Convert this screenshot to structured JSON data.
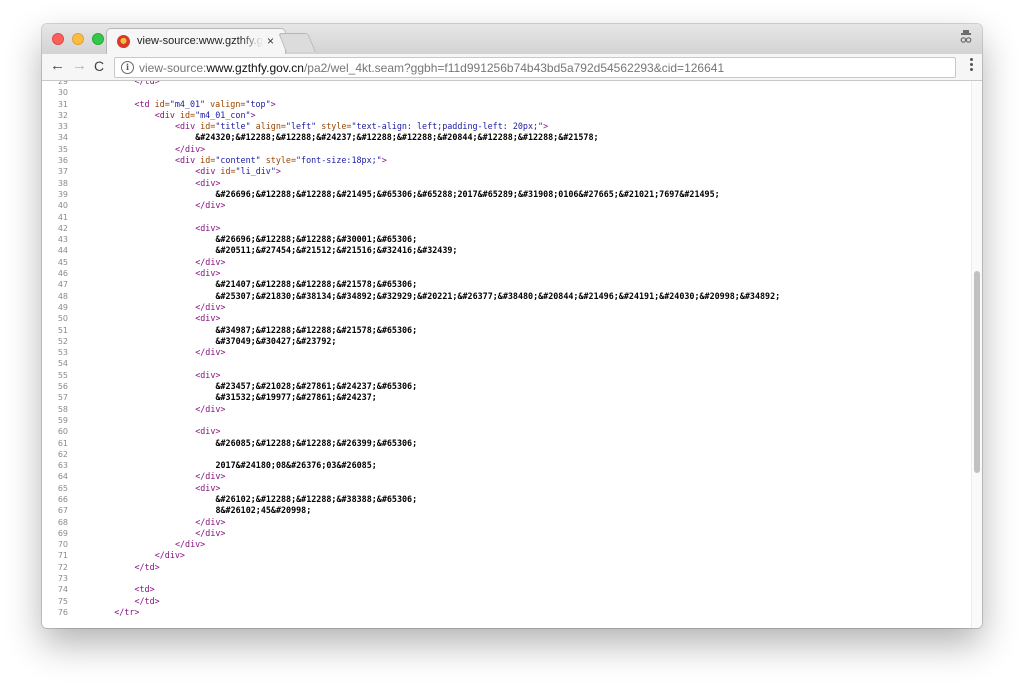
{
  "tab": {
    "title": "view-source:www.gzthfy.gov.cn",
    "close": "×"
  },
  "toolbar": {
    "url_scheme": "view-source:",
    "url_host": "www.gzthfy.gov.cn",
    "url_path": "/pa2/wel_4kt.seam?ggbh=f11d991256b74b43bd5a792d54562293&cid=126641",
    "back": "←",
    "forward": "→",
    "reload": "C"
  },
  "icons": {
    "favicon": "favicon-icon",
    "close": "close-icon",
    "profile": "incognito-icon",
    "back": "arrow-left-icon",
    "forward": "arrow-right-icon",
    "reload": "reload-icon",
    "info": "info-icon",
    "menu": "kebab-menu-icon"
  },
  "colors": {
    "tag": "#881280",
    "attribute": "#994500",
    "value": "#1a1aa6"
  },
  "source_lines": [
    {
      "n": "29",
      "indent": 8,
      "parts": [
        [
          "t",
          "</td>"
        ]
      ]
    },
    {
      "n": "30",
      "indent": 0,
      "parts": []
    },
    {
      "n": "31",
      "indent": 8,
      "parts": [
        [
          "t",
          "<td "
        ],
        [
          "a",
          "id="
        ],
        [
          "v",
          "\"m4_01\""
        ],
        [
          "a",
          " valign="
        ],
        [
          "v",
          "\"top\""
        ],
        [
          "t",
          ">"
        ]
      ]
    },
    {
      "n": "32",
      "indent": 12,
      "parts": [
        [
          "t",
          "<div "
        ],
        [
          "a",
          "id="
        ],
        [
          "v",
          "\"m4_01_con\""
        ],
        [
          "t",
          ">"
        ]
      ]
    },
    {
      "n": "33",
      "indent": 16,
      "parts": [
        [
          "t",
          "<div "
        ],
        [
          "a",
          "id="
        ],
        [
          "v",
          "\"title\""
        ],
        [
          "a",
          " align="
        ],
        [
          "v",
          "\"left\""
        ],
        [
          "a",
          " style="
        ],
        [
          "v",
          "\"text-align: left;padding-left: 20px;\""
        ],
        [
          "t",
          ">"
        ]
      ]
    },
    {
      "n": "34",
      "indent": 20,
      "parts": [
        [
          "x",
          "&#24320;&#12288;&#12288;&#24237;&#12288;&#12288;&#20844;&#12288;&#12288;&#21578;"
        ]
      ]
    },
    {
      "n": "35",
      "indent": 16,
      "parts": [
        [
          "t",
          "</div>"
        ]
      ]
    },
    {
      "n": "36",
      "indent": 16,
      "parts": [
        [
          "t",
          "<div "
        ],
        [
          "a",
          "id="
        ],
        [
          "v",
          "\"content\""
        ],
        [
          "a",
          " style="
        ],
        [
          "v",
          "\"font-size:18px;\""
        ],
        [
          "t",
          ">"
        ]
      ]
    },
    {
      "n": "37",
      "indent": 20,
      "parts": [
        [
          "t",
          "<div "
        ],
        [
          "a",
          "id="
        ],
        [
          "v",
          "\"li_div\""
        ],
        [
          "t",
          ">"
        ]
      ]
    },
    {
      "n": "38",
      "indent": 20,
      "parts": [
        [
          "t",
          "<div>"
        ]
      ]
    },
    {
      "n": "39",
      "indent": 24,
      "parts": [
        [
          "x",
          "&#26696;&#12288;&#12288;&#21495;&#65306;&#65288;2017&#65289;&#31908;0106&#27665;&#21021;7697&#21495;"
        ]
      ]
    },
    {
      "n": "40",
      "indent": 20,
      "parts": [
        [
          "t",
          "</div>"
        ]
      ]
    },
    {
      "n": "41",
      "indent": 0,
      "parts": []
    },
    {
      "n": "42",
      "indent": 20,
      "parts": [
        [
          "t",
          "<div>"
        ]
      ]
    },
    {
      "n": "43",
      "indent": 24,
      "parts": [
        [
          "x",
          "&#26696;&#12288;&#12288;&#30001;&#65306;"
        ]
      ]
    },
    {
      "n": "44",
      "indent": 24,
      "parts": [
        [
          "x",
          "&#20511;&#27454;&#21512;&#21516;&#32416;&#32439;"
        ]
      ]
    },
    {
      "n": "45",
      "indent": 20,
      "parts": [
        [
          "t",
          "</div>"
        ]
      ]
    },
    {
      "n": "46",
      "indent": 20,
      "parts": [
        [
          "t",
          "<div>"
        ]
      ]
    },
    {
      "n": "47",
      "indent": 24,
      "parts": [
        [
          "x",
          "&#21407;&#12288;&#12288;&#21578;&#65306;"
        ]
      ]
    },
    {
      "n": "48",
      "indent": 24,
      "parts": [
        [
          "x",
          "&#25307;&#21830;&#38134;&#34892;&#32929;&#20221;&#26377;&#38480;&#20844;&#21496;&#24191;&#24030;&#20998;&#34892;"
        ]
      ]
    },
    {
      "n": "49",
      "indent": 20,
      "parts": [
        [
          "t",
          "</div>"
        ]
      ]
    },
    {
      "n": "50",
      "indent": 20,
      "parts": [
        [
          "t",
          "<div>"
        ]
      ]
    },
    {
      "n": "51",
      "indent": 24,
      "parts": [
        [
          "x",
          "&#34987;&#12288;&#12288;&#21578;&#65306;"
        ]
      ]
    },
    {
      "n": "52",
      "indent": 24,
      "parts": [
        [
          "x",
          "&#37049;&#30427;&#23792;"
        ]
      ]
    },
    {
      "n": "53",
      "indent": 20,
      "parts": [
        [
          "t",
          "</div>"
        ]
      ]
    },
    {
      "n": "54",
      "indent": 0,
      "parts": []
    },
    {
      "n": "55",
      "indent": 20,
      "parts": [
        [
          "t",
          "<div>"
        ]
      ]
    },
    {
      "n": "56",
      "indent": 24,
      "parts": [
        [
          "x",
          "&#23457;&#21028;&#27861;&#24237;&#65306;"
        ]
      ]
    },
    {
      "n": "57",
      "indent": 24,
      "parts": [
        [
          "x",
          "&#31532;&#19977;&#27861;&#24237;"
        ]
      ]
    },
    {
      "n": "58",
      "indent": 20,
      "parts": [
        [
          "t",
          "</div>"
        ]
      ]
    },
    {
      "n": "59",
      "indent": 0,
      "parts": []
    },
    {
      "n": "60",
      "indent": 20,
      "parts": [
        [
          "t",
          "<div>"
        ]
      ]
    },
    {
      "n": "61",
      "indent": 24,
      "parts": [
        [
          "x",
          "&#26085;&#12288;&#12288;&#26399;&#65306;"
        ]
      ]
    },
    {
      "n": "62",
      "indent": 0,
      "parts": []
    },
    {
      "n": "63",
      "indent": 24,
      "parts": [
        [
          "x",
          "2017&#24180;08&#26376;03&#26085;"
        ]
      ]
    },
    {
      "n": "64",
      "indent": 20,
      "parts": [
        [
          "t",
          "</div>"
        ]
      ]
    },
    {
      "n": "65",
      "indent": 20,
      "parts": [
        [
          "t",
          "<div>"
        ]
      ]
    },
    {
      "n": "66",
      "indent": 24,
      "parts": [
        [
          "x",
          "&#26102;&#12288;&#12288;&#38388;&#65306;"
        ]
      ]
    },
    {
      "n": "67",
      "indent": 24,
      "parts": [
        [
          "x",
          "8&#26102;45&#20998;"
        ]
      ]
    },
    {
      "n": "68",
      "indent": 20,
      "parts": [
        [
          "t",
          "</div>"
        ]
      ]
    },
    {
      "n": "69",
      "indent": 20,
      "parts": [
        [
          "t",
          "</div>"
        ]
      ]
    },
    {
      "n": "70",
      "indent": 16,
      "parts": [
        [
          "t",
          "</div>"
        ]
      ]
    },
    {
      "n": "71",
      "indent": 12,
      "parts": [
        [
          "t",
          "</div>"
        ]
      ]
    },
    {
      "n": "72",
      "indent": 8,
      "parts": [
        [
          "t",
          "</td>"
        ]
      ]
    },
    {
      "n": "73",
      "indent": 0,
      "parts": []
    },
    {
      "n": "74",
      "indent": 8,
      "parts": [
        [
          "t",
          "<td>"
        ]
      ]
    },
    {
      "n": "75",
      "indent": 8,
      "parts": [
        [
          "t",
          "</td>"
        ]
      ]
    },
    {
      "n": "76",
      "indent": 4,
      "parts": [
        [
          "t",
          "</tr>"
        ]
      ]
    }
  ]
}
